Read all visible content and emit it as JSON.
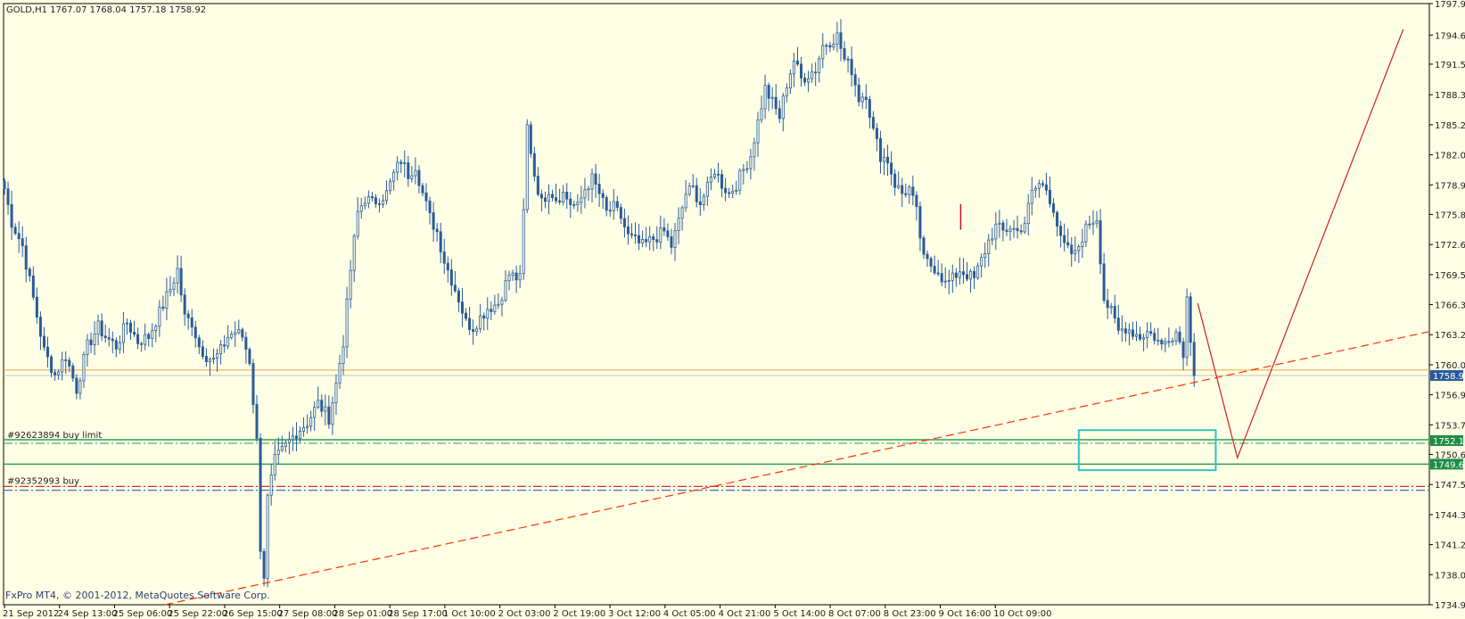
{
  "window": {
    "symbol_header": "GOLD,H1  1767.07 1768.04 1757.18 1758.92",
    "copyright": "FxPro MT4, © 2001-2012, MetaQuotes Software Corp."
  },
  "colors": {
    "background": "#ffffe6",
    "axis": "#000000",
    "bull": "#2a5b9b",
    "bear": "#2a5b9b",
    "signal": "#c8102e",
    "bid": "#c0c0c0",
    "ask": "#f0a040",
    "limit": "#2e9e55",
    "stop": "#d03030",
    "aux": "#3a6ec8",
    "trend": "#ff3300",
    "zigzag": "#cc2020",
    "box": "#2ec4c4",
    "price_label_bg": "#2a5b9b",
    "limit_label_bg": "#1e8e46"
  },
  "chart_data": {
    "type": "candlestick",
    "symbol": "GOLD",
    "timeframe": "H1",
    "ohlc_last": {
      "open": 1767.07,
      "high": 1768.04,
      "low": 1757.18,
      "close": 1758.92
    },
    "ylim": [
      1734.9,
      1797.9
    ],
    "y_ticks": [
      "1797.90",
      "1794.60",
      "1791.55",
      "1788.35",
      "1785.20",
      "1782.05",
      "1778.90",
      "1775.80",
      "1772.65",
      "1769.50",
      "1766.35",
      "1763.20",
      "1760.05",
      "1756.90",
      "1753.75",
      "1750.65",
      "1747.50",
      "1744.35",
      "1741.20",
      "1738.05",
      "1734.90"
    ],
    "x_ticks": [
      "21 Sep 2012",
      "24 Sep 13:00",
      "25 Sep 06:00",
      "25 Sep 22:00",
      "26 Sep 15:00",
      "27 Sep 08:00",
      "28 Sep 01:00",
      "28 Sep 17:00",
      "1 Oct 10:00",
      "2 Oct 03:00",
      "2 Oct 19:00",
      "3 Oct 12:00",
      "4 Oct 05:00",
      "4 Oct 21:00",
      "5 Oct 14:00",
      "8 Oct 07:00",
      "8 Oct 23:00",
      "9 Oct 16:00",
      "10 Oct 09:00"
    ],
    "anchors": [
      [
        0,
        1778.5
      ],
      [
        2,
        1775.0
      ],
      [
        5,
        1772.5
      ],
      [
        8,
        1767.0
      ],
      [
        11,
        1761.5
      ],
      [
        14,
        1759.0
      ],
      [
        17,
        1761.0
      ],
      [
        20,
        1757.5
      ],
      [
        23,
        1762.0
      ],
      [
        26,
        1764.0
      ],
      [
        28,
        1763.0
      ],
      [
        31,
        1762.0
      ],
      [
        34,
        1764.5
      ],
      [
        37,
        1762.5
      ],
      [
        40,
        1763.0
      ],
      [
        43,
        1765.5
      ],
      [
        46,
        1768.0
      ],
      [
        48,
        1770.0
      ],
      [
        50,
        1765.0
      ],
      [
        52,
        1764.5
      ],
      [
        54,
        1762.0
      ],
      [
        56,
        1761.0
      ],
      [
        58,
        1760.5
      ],
      [
        60,
        1761.5
      ],
      [
        62,
        1763.0
      ],
      [
        64,
        1763.5
      ],
      [
        66,
        1763.0
      ],
      [
        68,
        1760.5
      ],
      [
        70,
        1752.0
      ],
      [
        71,
        1741.0
      ],
      [
        72,
        1738.0
      ],
      [
        73,
        1746.0
      ],
      [
        75,
        1750.0
      ],
      [
        78,
        1751.5
      ],
      [
        81,
        1753.0
      ],
      [
        84,
        1754.0
      ],
      [
        87,
        1756.0
      ],
      [
        90,
        1754.5
      ],
      [
        92,
        1758.0
      ],
      [
        94,
        1762.5
      ],
      [
        96,
        1770.0
      ],
      [
        98,
        1776.0
      ],
      [
        100,
        1777.5
      ],
      [
        102,
        1777.0
      ],
      [
        104,
        1777.5
      ],
      [
        106,
        1778.0
      ],
      [
        108,
        1780.0
      ],
      [
        110,
        1781.5
      ],
      [
        112,
        1780.0
      ],
      [
        114,
        1781.0
      ],
      [
        116,
        1778.0
      ],
      [
        118,
        1775.5
      ],
      [
        120,
        1774.0
      ],
      [
        122,
        1771.0
      ],
      [
        124,
        1769.0
      ],
      [
        126,
        1767.0
      ],
      [
        128,
        1764.5
      ],
      [
        130,
        1764.0
      ],
      [
        132,
        1765.0
      ],
      [
        134,
        1766.0
      ],
      [
        137,
        1766.5
      ],
      [
        140,
        1769.5
      ],
      [
        143,
        1769.0
      ],
      [
        144,
        1776.0
      ],
      [
        145,
        1785.0
      ],
      [
        147,
        1780.0
      ],
      [
        149,
        1777.0
      ],
      [
        151,
        1778.5
      ],
      [
        153,
        1777.5
      ],
      [
        155,
        1778.0
      ],
      [
        157,
        1777.0
      ],
      [
        159,
        1776.5
      ],
      [
        161,
        1778.5
      ],
      [
        163,
        1779.5
      ],
      [
        165,
        1778.0
      ],
      [
        167,
        1776.0
      ],
      [
        169,
        1776.5
      ],
      [
        171,
        1775.5
      ],
      [
        173,
        1773.5
      ],
      [
        175,
        1773.0
      ],
      [
        177,
        1772.5
      ],
      [
        179,
        1773.0
      ],
      [
        181,
        1773.5
      ],
      [
        183,
        1774.0
      ],
      [
        185,
        1772.5
      ],
      [
        187,
        1775.0
      ],
      [
        189,
        1778.0
      ],
      [
        191,
        1778.5
      ],
      [
        193,
        1777.0
      ],
      [
        195,
        1778.5
      ],
      [
        197,
        1780.5
      ],
      [
        199,
        1779.0
      ],
      [
        201,
        1778.0
      ],
      [
        203,
        1779.0
      ],
      [
        205,
        1780.5
      ],
      [
        207,
        1782.0
      ],
      [
        209,
        1785.5
      ],
      [
        211,
        1789.0
      ],
      [
        213,
        1787.5
      ],
      [
        215,
        1786.0
      ],
      [
        217,
        1789.5
      ],
      [
        219,
        1792.0
      ],
      [
        221,
        1790.0
      ],
      [
        223,
        1790.5
      ],
      [
        225,
        1791.0
      ],
      [
        227,
        1793.5
      ],
      [
        229,
        1794.0
      ],
      [
        231,
        1794.5
      ],
      [
        233,
        1792.0
      ],
      [
        235,
        1791.0
      ],
      [
        237,
        1788.0
      ],
      [
        239,
        1788.5
      ],
      [
        241,
        1784.5
      ],
      [
        243,
        1782.0
      ],
      [
        245,
        1781.5
      ],
      [
        247,
        1779.0
      ],
      [
        249,
        1778.0
      ],
      [
        251,
        1778.5
      ],
      [
        253,
        1776.0
      ],
      [
        255,
        1771.0
      ],
      [
        257,
        1770.5
      ],
      [
        259,
        1770.0
      ],
      [
        261,
        1768.5
      ],
      [
        263,
        1769.0
      ],
      [
        265,
        1770.0
      ],
      [
        267,
        1769.5
      ],
      [
        269,
        1769.0
      ],
      [
        271,
        1771.0
      ],
      [
        273,
        1773.0
      ],
      [
        275,
        1774.5
      ],
      [
        277,
        1774.0
      ],
      [
        279,
        1774.5
      ],
      [
        281,
        1774.0
      ],
      [
        283,
        1775.0
      ],
      [
        285,
        1778.0
      ],
      [
        287,
        1779.0
      ],
      [
        289,
        1778.5
      ],
      [
        291,
        1776.5
      ],
      [
        293,
        1773.0
      ],
      [
        295,
        1772.0
      ],
      [
        297,
        1771.5
      ],
      [
        299,
        1773.5
      ],
      [
        301,
        1775.0
      ],
      [
        303,
        1775.5
      ],
      [
        305,
        1767.0
      ],
      [
        307,
        1765.5
      ],
      [
        309,
        1763.5
      ],
      [
        311,
        1764.0
      ],
      [
        313,
        1763.5
      ],
      [
        315,
        1763.0
      ],
      [
        317,
        1763.5
      ],
      [
        319,
        1763.0
      ],
      [
        321,
        1762.0
      ],
      [
        323,
        1763.0
      ],
      [
        325,
        1763.5
      ],
      [
        327,
        1761.5
      ],
      [
        328,
        1767.0
      ],
      [
        330,
        1758.92
      ]
    ],
    "bid_price": 1758.92,
    "ask_level": 1759.5,
    "orders": [
      {
        "label": "#92623894 buy limit",
        "price": 1752.1,
        "price_label": "1752.10"
      },
      {
        "label": "#92352993 buy",
        "price": 1747.3
      }
    ],
    "levels": [
      {
        "price": 1749.63,
        "price_label": "1749.63"
      },
      {
        "price": 1746.9
      }
    ],
    "price_label": "1758.92",
    "trendline": {
      "x1": 0,
      "y1": 1734.9,
      "x2": 395,
      "y2": 1763.5
    },
    "zigzag": [
      [
        331,
        1766.5
      ],
      [
        342,
        1750.3
      ],
      [
        388,
        1795.2
      ]
    ],
    "box": {
      "x1": 298,
      "x2": 336,
      "y1": 1753.2,
      "y2": 1749.0
    }
  }
}
